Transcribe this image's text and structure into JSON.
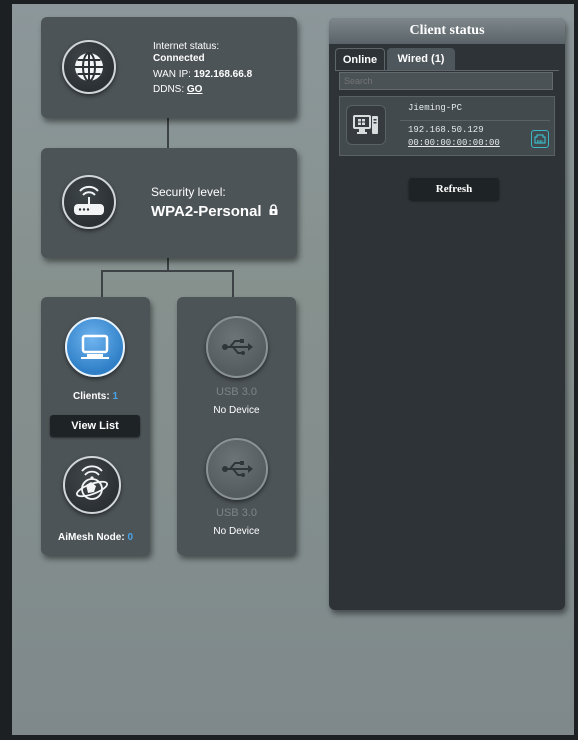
{
  "internet": {
    "status_label": "Internet status:",
    "status_value": "Connected",
    "wan_ip_label": "WAN IP:",
    "wan_ip_value": "192.168.66.8",
    "ddns_label": "DDNS:",
    "ddns_link": "GO",
    "icon": "globe-icon"
  },
  "security": {
    "label": "Security level:",
    "value": "WPA2-Personal",
    "icon": "router-icon",
    "lock_icon": "lock-icon"
  },
  "clients": {
    "label": "Clients:",
    "count": "1",
    "view_list": "View List",
    "icon": "monitor-icon"
  },
  "aimesh": {
    "label": "AiMesh Node:",
    "count": "0",
    "icon": "aimesh-icon"
  },
  "usb": [
    {
      "port": "USB 3.0",
      "status": "No Device",
      "icon": "usb-icon"
    },
    {
      "port": "USB 3.0",
      "status": "No Device",
      "icon": "usb-icon"
    }
  ],
  "client_status": {
    "title": "Client status",
    "tabs": [
      {
        "label": "Online",
        "active": true
      },
      {
        "label": "Wired (1)",
        "active": false
      }
    ],
    "search_placeholder": "Search",
    "devices": [
      {
        "name": "Jieming-PC",
        "ip": "192.168.50.129",
        "mac": "00:00:00:00:00:00",
        "type_icon": "windows-pc-icon",
        "conn_icon": "ethernet-icon"
      }
    ],
    "refresh": "Refresh"
  },
  "colors": {
    "accent_blue": "#4aa3e8",
    "card": "#4d5457",
    "panel": "#2d3336"
  }
}
